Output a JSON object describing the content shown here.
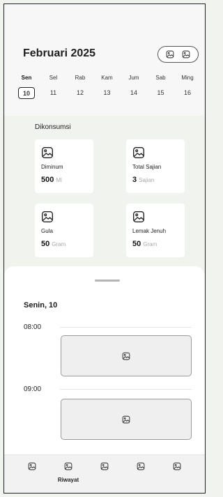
{
  "header": {
    "month_title": "Februari 2025",
    "pill_icons": [
      "image-icon",
      "image-icon"
    ]
  },
  "week": {
    "days": [
      {
        "name": "Sen",
        "num": "10",
        "active": true
      },
      {
        "name": "Sel",
        "num": "11",
        "active": false
      },
      {
        "name": "Rab",
        "num": "12",
        "active": false
      },
      {
        "name": "Kam",
        "num": "13",
        "active": false
      },
      {
        "name": "Jum",
        "num": "14",
        "active": false
      },
      {
        "name": "Sab",
        "num": "15",
        "active": false
      },
      {
        "name": "Ming",
        "num": "16",
        "active": false
      }
    ]
  },
  "consumed": {
    "title": "Dikonsumsi",
    "cards": [
      {
        "label": "Diminum",
        "value": "500",
        "unit": "Ml",
        "icon": "image-icon"
      },
      {
        "label": "Total Sajian",
        "value": "3",
        "unit": "Sajian",
        "icon": "image-icon"
      },
      {
        "label": "Gula",
        "value": "50",
        "unit": "Gram",
        "icon": "image-icon"
      },
      {
        "label": "Lemak Jenuh",
        "value": "50",
        "unit": "Gram",
        "icon": "image-icon"
      }
    ]
  },
  "schedule": {
    "date_title": "Senin, 10",
    "slots": [
      {
        "time": "08:00",
        "icon": "image-icon"
      },
      {
        "time": "09:00",
        "icon": "image-icon"
      }
    ]
  },
  "nav": {
    "items": [
      {
        "label": "",
        "icon": "image-icon"
      },
      {
        "label": "Riwayat",
        "icon": "image-icon"
      },
      {
        "label": "",
        "icon": "image-icon"
      },
      {
        "label": "",
        "icon": "image-icon"
      },
      {
        "label": "",
        "icon": "image-icon"
      }
    ]
  }
}
